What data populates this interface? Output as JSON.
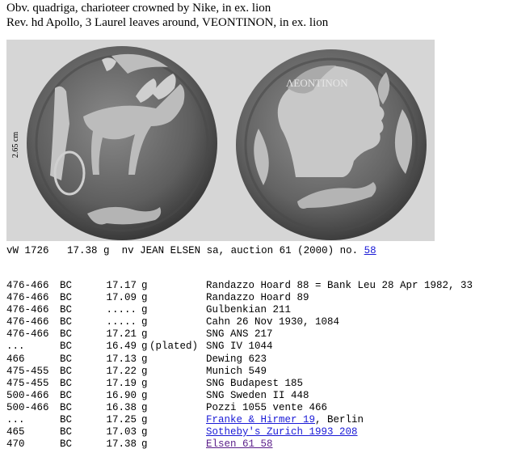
{
  "captions": {
    "obverse": "Obv. quadriga, charioteer crowned by Nike, in ex. lion",
    "reverse": "Rev. hd Apollo, 3 Laurel leaves around, VEONTINON, in ex. lion"
  },
  "photo": {
    "scale_label": "2.65 cm",
    "reverse_legend": "ΛΕΟΝΤΙΝΟΝ"
  },
  "spec": {
    "id": "vW 1726",
    "weight": "17.38 g",
    "source": "nv JEAN ELSEN sa, auction 61 (2000) no.",
    "link": "58"
  },
  "records": [
    {
      "date": "476-466",
      "era": "BC",
      "weight": "17.17",
      "unit": "g",
      "note": "",
      "ref": "Randazzo Hoard 88 = Bank Leu 28 Apr 1982, 33",
      "suffix": "",
      "link": false
    },
    {
      "date": "476-466",
      "era": "BC",
      "weight": "17.09",
      "unit": "g",
      "note": "",
      "ref": "Randazzo Hoard 89",
      "suffix": "",
      "link": false
    },
    {
      "date": "476-466",
      "era": "BC",
      "weight": ".....",
      "unit": "g",
      "note": "",
      "ref": "Gulbenkian 211",
      "suffix": "",
      "link": false
    },
    {
      "date": "476-466",
      "era": "BC",
      "weight": ".....",
      "unit": "g",
      "note": "",
      "ref": "Cahn 26 Nov 1930, 1084",
      "suffix": "",
      "link": false
    },
    {
      "date": "476-466",
      "era": "BC",
      "weight": "17.21",
      "unit": "g",
      "note": "",
      "ref": "SNG ANS 217",
      "suffix": "",
      "link": false
    },
    {
      "date": "...",
      "era": "BC",
      "weight": "16.49",
      "unit": "g",
      "note": "(plated)",
      "ref": "SNG IV 1044",
      "suffix": "",
      "link": false
    },
    {
      "date": "466",
      "era": "BC",
      "weight": "17.13",
      "unit": "g",
      "note": "",
      "ref": "Dewing 623",
      "suffix": "",
      "link": false
    },
    {
      "date": "475-455",
      "era": "BC",
      "weight": "17.22",
      "unit": "g",
      "note": "",
      "ref": "Munich 549",
      "suffix": "",
      "link": false
    },
    {
      "date": "475-455",
      "era": "BC",
      "weight": "17.19",
      "unit": "g",
      "note": "",
      "ref": "SNG Budapest 185",
      "suffix": "",
      "link": false
    },
    {
      "date": "500-466",
      "era": "BC",
      "weight": "16.90",
      "unit": "g",
      "note": "",
      "ref": "SNG Sweden II 448",
      "suffix": "",
      "link": false
    },
    {
      "date": "500-466",
      "era": "BC",
      "weight": "16.38",
      "unit": "g",
      "note": "",
      "ref": "Pozzi 1055 vente 466",
      "suffix": "",
      "link": false
    },
    {
      "date": "...",
      "era": "BC",
      "weight": "17.25",
      "unit": "g",
      "note": "",
      "ref": "Franke & Hirmer 19",
      "suffix": ", Berlin",
      "link": true
    },
    {
      "date": "465",
      "era": "BC",
      "weight": "17.03",
      "unit": "g",
      "note": "",
      "ref": "Sotheby's Zurich 1993 208",
      "suffix": "",
      "link": true
    },
    {
      "date": "470",
      "era": "BC",
      "weight": "17.38",
      "unit": "g",
      "note": "",
      "ref": "Elsen 61 58",
      "suffix": "",
      "link": true,
      "visited": true
    }
  ]
}
